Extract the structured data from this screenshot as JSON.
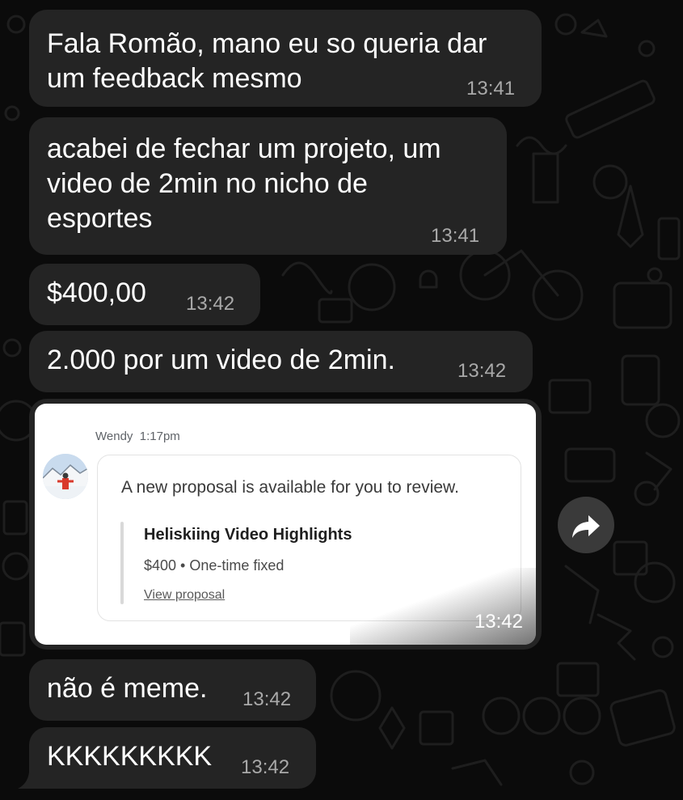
{
  "messages": [
    {
      "text": "Fala Romão, mano eu so queria dar\num feedback mesmo",
      "time": "13:41"
    },
    {
      "text": "acabei de fechar um projeto, um\nvideo de 2min no nicho de\nesportes",
      "time": "13:41"
    },
    {
      "text": "$400,00",
      "time": "13:42"
    },
    {
      "text": "2.000 por um video de 2min.",
      "time": "13:42"
    },
    {
      "text": "não é meme.",
      "time": "13:42"
    },
    {
      "text": "KKKKKKKKK",
      "time": "13:42"
    }
  ],
  "image_message": {
    "time": "13:42",
    "screenshot": {
      "sender": "Wendy",
      "sent_time": "1:17pm",
      "message": "A new proposal is available for you to review.",
      "proposal_title": "Heliskiing Video Highlights",
      "proposal_price": "$400 • One-time fixed",
      "link": "View proposal"
    }
  },
  "icons": {
    "forward": "forward-arrow-icon",
    "avatar": "skier-avatar-image"
  },
  "colors": {
    "background": "#0b0b0b",
    "bubble": "#242424",
    "text": "#ffffff",
    "timestamp": "#a9a9a9"
  }
}
